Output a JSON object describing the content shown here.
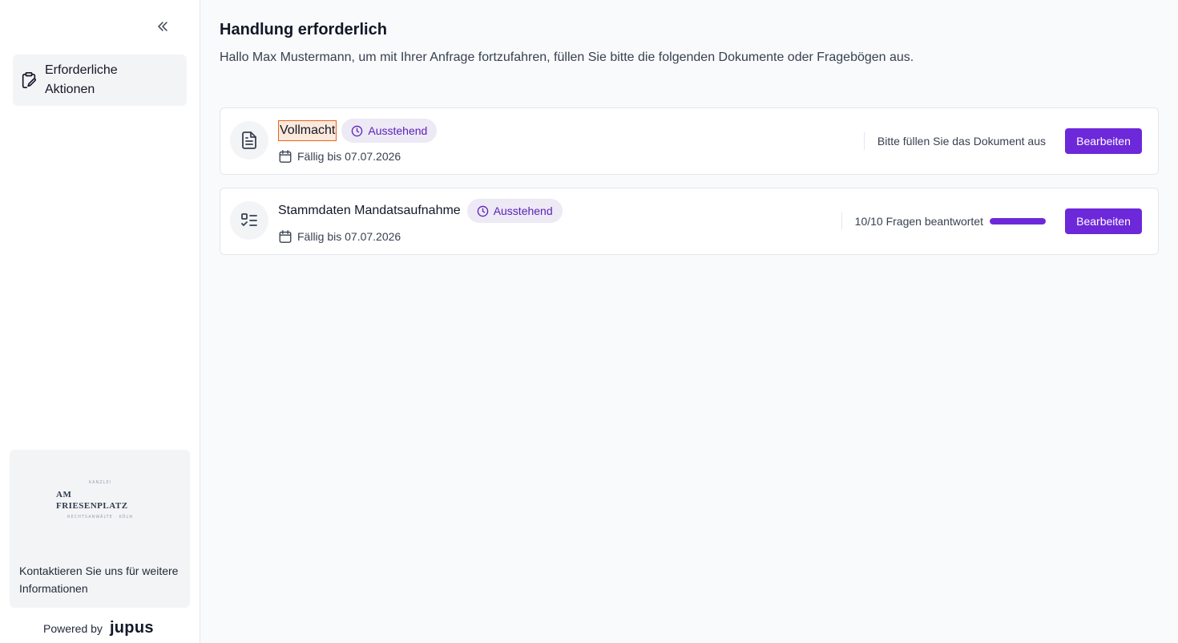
{
  "sidebar": {
    "nav_items": [
      {
        "label": "Erforderliche Aktionen",
        "icon": "clipboard-signature-icon"
      }
    ],
    "firm": {
      "logo_top_text": "KANZLEI",
      "logo_name": "AM FRIESENPLATZ",
      "logo_sub_text": "RECHTSANWÄLTE · KÖLN",
      "contact_text": "Kontaktieren Sie uns für weitere Informationen"
    },
    "powered_by": {
      "label": "Powered by",
      "brand": "jupus"
    }
  },
  "main": {
    "title": "Handlung erforderlich",
    "subtitle": "Hallo Max Mustermann, um mit Ihrer Anfrage fortzufahren, füllen Sie bitte die folgenden Dokumente oder Fragebögen aus.",
    "tasks": [
      {
        "title": "Vollmacht",
        "icon": "document-icon",
        "status": "Ausstehend",
        "due": "Fällig bis 07.07.2026",
        "info": "Bitte füllen Sie das Dokument aus",
        "button": "Bearbeiten"
      },
      {
        "title": "Stammdaten Mandatsaufnahme",
        "icon": "checklist-icon",
        "status": "Ausstehend",
        "due": "Fällig bis 07.07.2026",
        "info": "10/10 Fragen beantwortet",
        "progress": 1.0,
        "button": "Bearbeiten"
      }
    ]
  },
  "colors": {
    "accent": "#6d28d9",
    "badge_bg": "#ede9f5",
    "badge_text": "#5b21b6",
    "highlight_border": "#e8661b",
    "highlight_bg": "#fde8dc"
  }
}
